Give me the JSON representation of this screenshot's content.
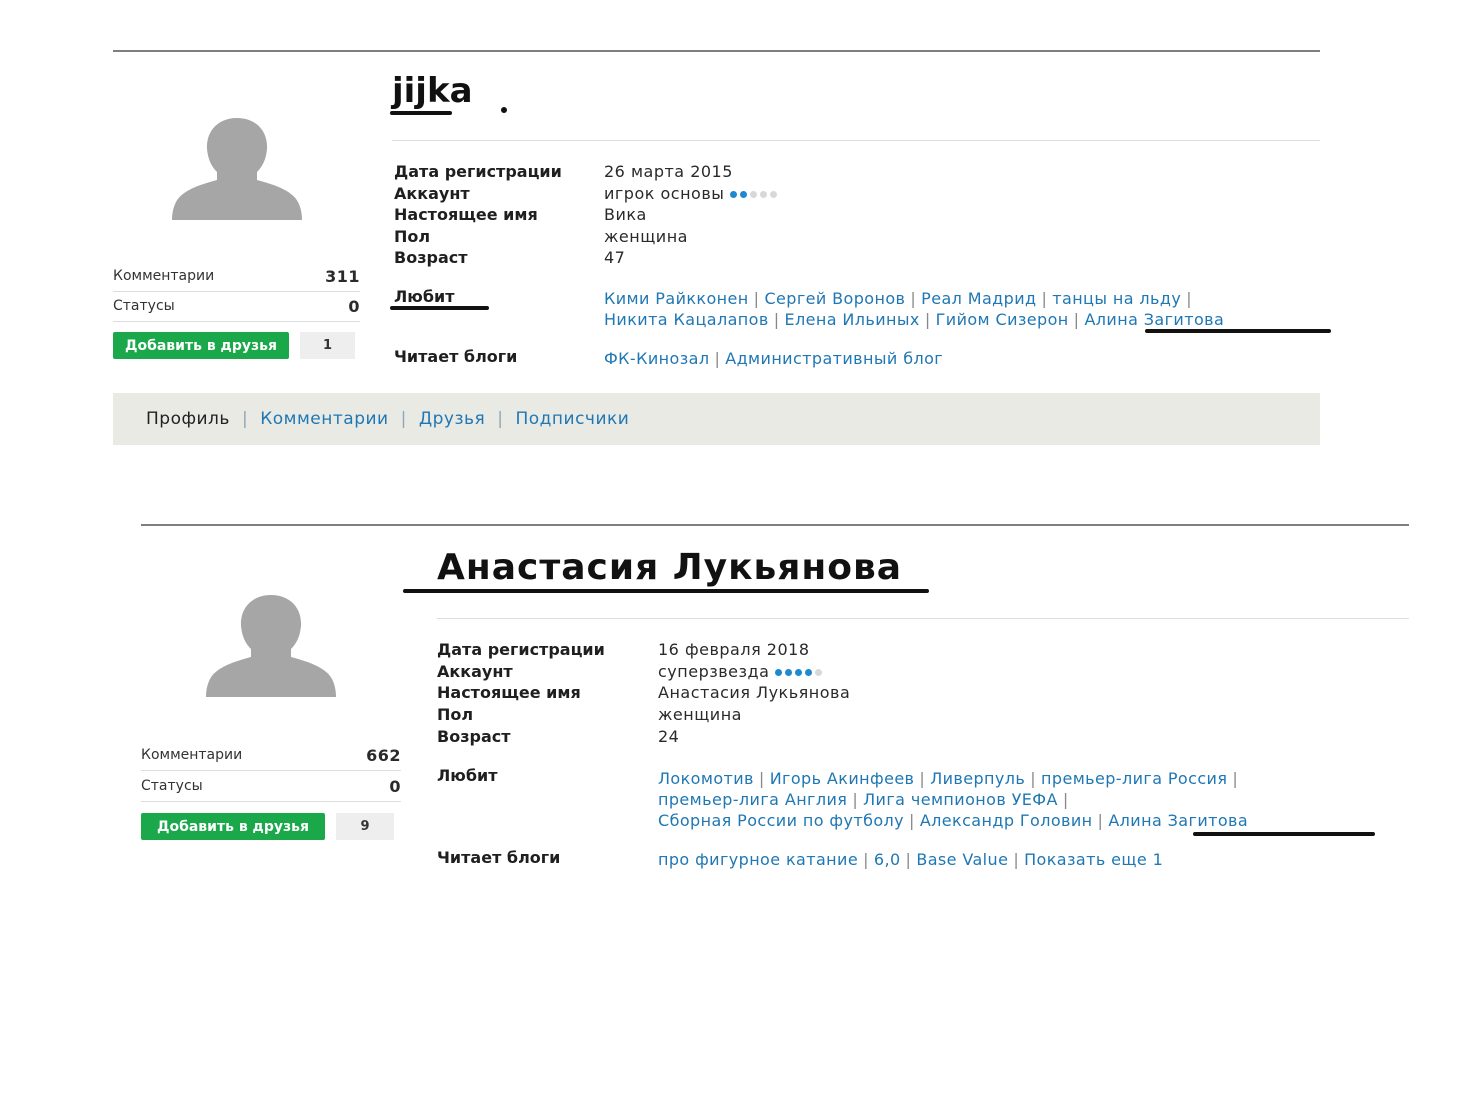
{
  "profiles": [
    {
      "username": "jijka",
      "stats": {
        "comments_label": "Комментарии",
        "comments_value": "311",
        "statuses_label": "Статусы",
        "statuses_value": "0"
      },
      "add_friend_label": "Добавить в друзья",
      "friend_count": "1",
      "info": {
        "registration_label": "Дата регистрации",
        "registration_value": "26 марта 2015",
        "account_label": "Аккаунт",
        "account_value": "игрок основы",
        "account_level": 2,
        "account_level_max": 5,
        "real_name_label": "Настоящее имя",
        "real_name_value": "Вика",
        "gender_label": "Пол",
        "gender_value": "женщина",
        "age_label": "Возраст",
        "age_value": "47",
        "likes_label": "Любит",
        "likes": [
          "Кими Райкконен",
          "Сергей Воронов",
          "Реал Мадрид",
          "танцы на льду",
          "Никита Кацалапов",
          "Елена Ильиных",
          "Гийом Сизерон",
          "Алина Загитова"
        ],
        "blogs_label": "Читает блоги",
        "blogs": [
          "ФК-Кинозал",
          "Административный блог"
        ]
      },
      "tabs": [
        "Профиль",
        "Комментарии",
        "Друзья",
        "Подписчики"
      ]
    },
    {
      "username": "Анастасия Лукьянова",
      "stats": {
        "comments_label": "Комментарии",
        "comments_value": "662",
        "statuses_label": "Статусы",
        "statuses_value": "0"
      },
      "add_friend_label": "Добавить в друзья",
      "friend_count": "9",
      "info": {
        "registration_label": "Дата регистрации",
        "registration_value": "16 февраля 2018",
        "account_label": "Аккаунт",
        "account_value": "суперзвезда",
        "account_level": 4,
        "account_level_max": 5,
        "real_name_label": "Настоящее имя",
        "real_name_value": "Анастасия Лукьянова",
        "gender_label": "Пол",
        "gender_value": "женщина",
        "age_label": "Возраст",
        "age_value": "24",
        "likes_label": "Любит",
        "likes": [
          "Локомотив",
          "Игорь Акинфеев",
          "Ливерпуль",
          "премьер-лига Россия",
          "премьер-лига Англия",
          "Лига чемпионов УЕФА",
          "Сборная России по футболу",
          "Александр Головин",
          "Алина Загитова"
        ],
        "blogs_label": "Читает блоги",
        "blogs": [
          "про фигурное катание",
          "6,0",
          "Base Value",
          "Показать еще 1"
        ]
      }
    }
  ],
  "colors": {
    "link": "#1f77b4",
    "button_green": "#1aa84a",
    "tab_bar_bg": "#eaeae5",
    "avatar_gray": "#a6a6a6",
    "level_dot_on": "#1e88d0"
  },
  "icons": {
    "avatar": "user-silhouette-icon"
  }
}
